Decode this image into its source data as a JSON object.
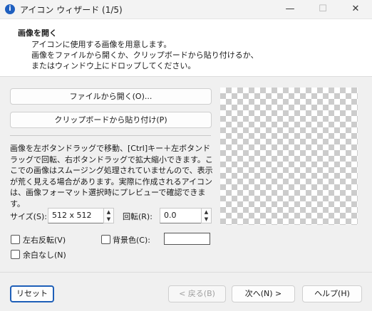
{
  "window": {
    "title": "アイコン ウィザード (1/5)",
    "app_icon_glyph": "i",
    "minimize_glyph": "—",
    "maximize_glyph": "☐",
    "close_glyph": "✕"
  },
  "header": {
    "title": "画像を開く",
    "lines": [
      "アイコンに使用する画像を用意します。",
      "画像をファイルから開くか、クリップボードから貼り付けるか、",
      "またはウィンドウ上にドロップしてください。"
    ]
  },
  "actions": {
    "open_file": "ファイルから開く(O)...",
    "paste_clipboard": "クリップボードから貼り付け(P)"
  },
  "description": "画像を左ボタンドラッグで移動、[Ctrl]キー＋左ボタンドラッグで回転、右ボタンドラッグで拡大縮小できます。ここでの画像はスムージング処理されていませんので、表示が荒く見える場合があります。実際に作成されるアイコンは、画像フォーマット選択時にプレビューで確認できます。",
  "controls": {
    "size_label": "サイズ(S):",
    "size_value": "512 x 512",
    "rotation_label": "回転(R):",
    "rotation_value": "0.0",
    "spin_up": "▲",
    "spin_down": "▼",
    "flip_label": "左右反転(V)",
    "flip_checked": false,
    "bg_color_label": "背景色(C):",
    "bg_color_checked": false,
    "no_margin_label": "余白なし(N)",
    "no_margin_checked": false,
    "bg_color_value": "#ffffff"
  },
  "footer": {
    "reset": "リセット",
    "back": "< 戻る(B)",
    "next": "次へ(N) >",
    "help": "ヘルプ(H)"
  },
  "colors": {
    "accent": "#1e5fb8",
    "checker": "#cccccc"
  }
}
